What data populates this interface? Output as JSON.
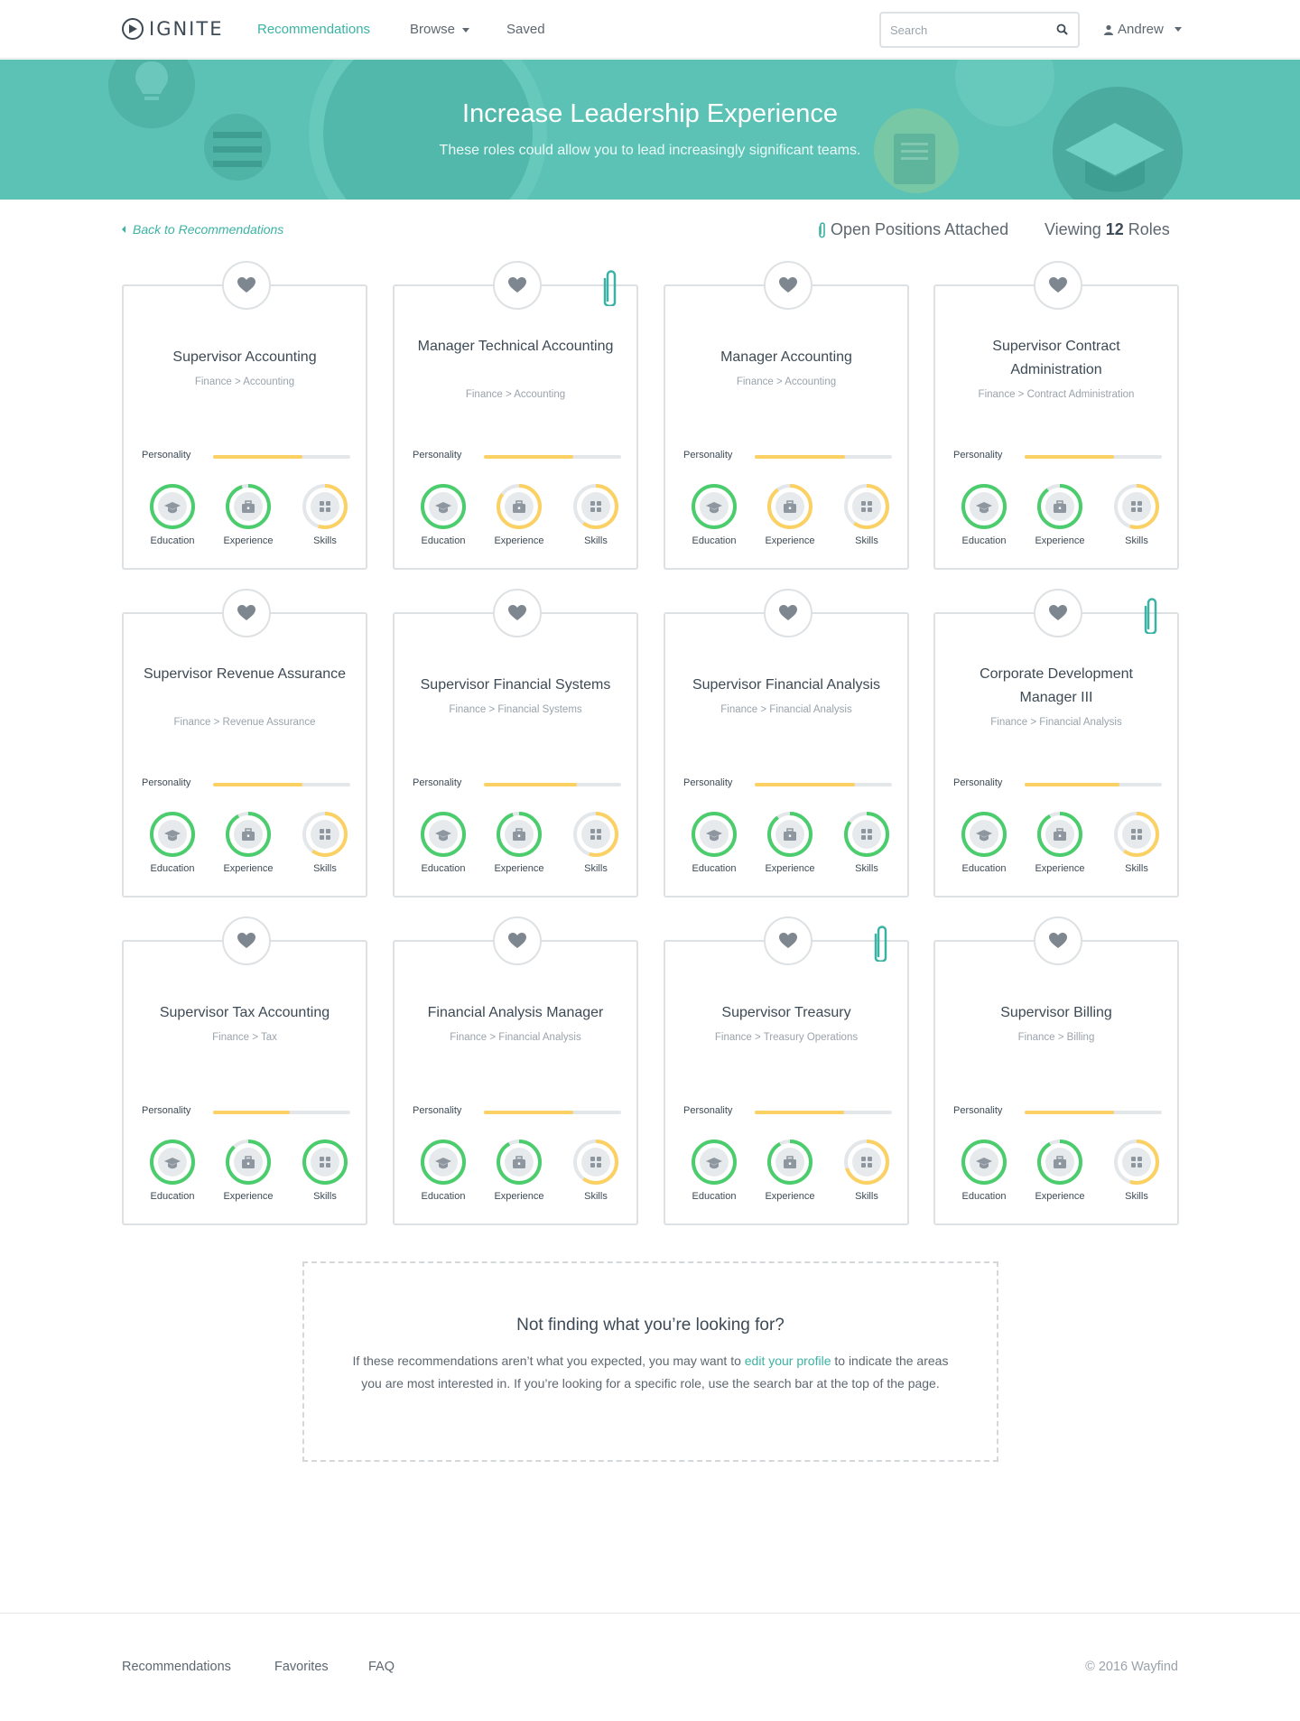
{
  "nav": {
    "logo": "IGNITE",
    "links": [
      {
        "label": "Recommendations",
        "active": true
      },
      {
        "label": "Browse",
        "dropdown": true
      },
      {
        "label": "Saved"
      }
    ],
    "search_placeholder": "Search",
    "user": "Andrew"
  },
  "hero": {
    "title": "Increase Leadership Experience",
    "subtitle": "These roles could allow you to lead increasingly significant teams."
  },
  "subheader": {
    "back_label": "Back to Recommendations",
    "open_positions": "Open Positions Attached",
    "viewing_prefix": "Viewing",
    "viewing_count": "12",
    "viewing_suffix": "Roles"
  },
  "labels": {
    "personality": "Personality",
    "education": "Education",
    "experience": "Experience",
    "skills": "Skills"
  },
  "colors": {
    "accent": "#3bb3a4",
    "match_high": "#4ccd6d",
    "match_medium": "#fbd163",
    "track": "#e4e7e9"
  },
  "roles": [
    {
      "title": "Supervisor Accounting",
      "path": "Finance > Accounting",
      "attached": false,
      "personality": 0.65,
      "education": {
        "level": "high",
        "fill": 1.0
      },
      "experience": {
        "level": "high",
        "fill": 0.95
      },
      "skills": {
        "level": "medium",
        "fill": 0.55
      }
    },
    {
      "title": "Manager Technical Accounting",
      "path": "Finance > Accounting",
      "attached": true,
      "personality": 0.65,
      "education": {
        "level": "high",
        "fill": 1.0
      },
      "experience": {
        "level": "medium",
        "fill": 0.85
      },
      "skills": {
        "level": "medium",
        "fill": 0.6
      }
    },
    {
      "title": "Manager Accounting",
      "path": "Finance > Accounting",
      "attached": false,
      "personality": 0.66,
      "education": {
        "level": "high",
        "fill": 1.0
      },
      "experience": {
        "level": "medium",
        "fill": 0.9
      },
      "skills": {
        "level": "medium",
        "fill": 0.6
      }
    },
    {
      "title": "Supervisor Contract Administration",
      "path": "Finance > Contract Administration",
      "attached": false,
      "personality": 0.65,
      "education": {
        "level": "high",
        "fill": 1.0
      },
      "experience": {
        "level": "high",
        "fill": 0.9
      },
      "skills": {
        "level": "medium",
        "fill": 0.55
      }
    },
    {
      "title": "Supervisor Revenue Assurance",
      "path": "Finance > Revenue Assurance",
      "attached": false,
      "personality": 0.65,
      "education": {
        "level": "high",
        "fill": 1.0
      },
      "experience": {
        "level": "high",
        "fill": 0.92
      },
      "skills": {
        "level": "medium",
        "fill": 0.6
      }
    },
    {
      "title": "Supervisor Financial Systems",
      "path": "Finance > Financial Systems",
      "attached": false,
      "personality": 0.68,
      "education": {
        "level": "high",
        "fill": 1.0
      },
      "experience": {
        "level": "high",
        "fill": 0.95
      },
      "skills": {
        "level": "medium",
        "fill": 0.55
      }
    },
    {
      "title": "Supervisor Financial Analysis",
      "path": "Finance > Financial Analysis",
      "attached": false,
      "personality": 0.73,
      "education": {
        "level": "high",
        "fill": 1.0
      },
      "experience": {
        "level": "high",
        "fill": 0.9
      },
      "skills": {
        "level": "high",
        "fill": 0.85
      }
    },
    {
      "title": "Corporate Development Manager III",
      "path": "Finance > Financial Analysis",
      "attached": true,
      "personality": 0.69,
      "education": {
        "level": "high",
        "fill": 1.0
      },
      "experience": {
        "level": "high",
        "fill": 0.92
      },
      "skills": {
        "level": "medium",
        "fill": 0.6
      }
    },
    {
      "title": "Supervisor Tax Accounting",
      "path": "Finance > Tax",
      "attached": false,
      "personality": 0.56,
      "education": {
        "level": "high",
        "fill": 1.0
      },
      "experience": {
        "level": "high",
        "fill": 0.88
      },
      "skills": {
        "level": "high",
        "fill": 1.0
      }
    },
    {
      "title": "Financial Analysis Manager",
      "path": "Finance > Financial Analysis",
      "attached": false,
      "personality": 0.65,
      "education": {
        "level": "high",
        "fill": 1.0
      },
      "experience": {
        "level": "high",
        "fill": 0.92
      },
      "skills": {
        "level": "medium",
        "fill": 0.6
      }
    },
    {
      "title": "Supervisor Treasury",
      "path": "Finance > Treasury Operations",
      "attached": true,
      "personality": 0.65,
      "education": {
        "level": "high",
        "fill": 1.0
      },
      "experience": {
        "level": "high",
        "fill": 0.92
      },
      "skills": {
        "level": "medium",
        "fill": 0.7
      }
    },
    {
      "title": "Supervisor Billing",
      "path": "Finance > Billing",
      "attached": false,
      "personality": 0.65,
      "education": {
        "level": "high",
        "fill": 1.0
      },
      "experience": {
        "level": "high",
        "fill": 0.92
      },
      "skills": {
        "level": "medium",
        "fill": 0.55
      }
    }
  ],
  "info": {
    "title": "Not finding what you’re looking for?",
    "text_before": "If these recommendations aren’t what you expected, you may want to ",
    "link": "edit your profile",
    "text_after": " to indicate the areas you are most interested in. If you’re looking for a specific role, use the search bar at the top of the page."
  },
  "footer": {
    "links": [
      "Recommendations",
      "Favorites",
      "FAQ"
    ],
    "copyright": "© 2016 Wayfind"
  }
}
